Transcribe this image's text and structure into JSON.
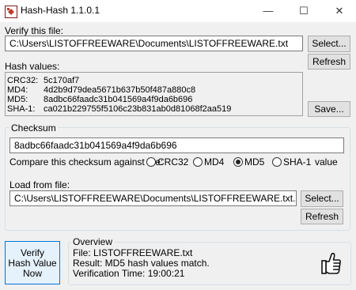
{
  "window": {
    "title": "Hash-Hash 1.1.0.1",
    "min_glyph": "—",
    "max_glyph": "☐",
    "close_glyph": "✕"
  },
  "verify": {
    "label": "Verify this file:",
    "path": "C:\\Users\\LISTOFFREEWARE\\Documents\\LISTOFFREEWARE.txt",
    "select_label": "Select...",
    "refresh_label": "Refresh"
  },
  "hashes": {
    "label": "Hash values:",
    "rows": [
      {
        "key": "CRC32:",
        "value": "5c170af7"
      },
      {
        "key": "MD4:",
        "value": "4d2b9d79dea5671b637b50f487a880c8"
      },
      {
        "key": "MD5:",
        "value": "8adbc66faadc31b041569a4f9da6b696"
      },
      {
        "key": "SHA-1:",
        "value": "ca021b229755f5106c23b831ab0d81068f2aa519"
      }
    ],
    "save_label": "Save..."
  },
  "checksum": {
    "group_label": "Checksum",
    "value": "8adbc66faadc31b041569a4f9da6b696",
    "compare_label": "Compare this checksum against the:",
    "options": [
      "CRC32",
      "MD4",
      "MD5",
      "SHA-1"
    ],
    "selected": "MD5",
    "suffix": "value",
    "load_label": "Load from file:",
    "load_path": "C:\\Users\\LISTOFFREEWARE\\Documents\\LISTOFFREEWARE.txt.sfv",
    "select_label": "Select...",
    "refresh_label": "Refresh"
  },
  "verify_button": {
    "line1": "Verify",
    "line2": "Hash Value",
    "line3": "Now"
  },
  "overview": {
    "group_label": "Overview",
    "file_line": "File: LISTOFFREEWARE.txt",
    "result_line": "Result: MD5 hash values match.",
    "time_line": "Verification Time: 19:00:21",
    "result_icon": "thumbs-up-icon"
  }
}
